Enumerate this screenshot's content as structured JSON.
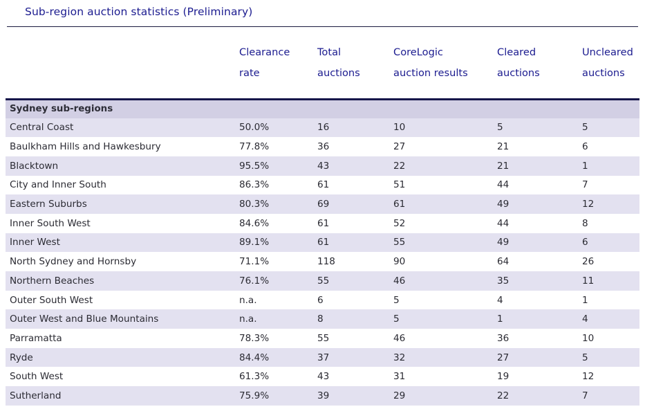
{
  "title": "Sub-region auction statistics (Preliminary)",
  "columns": [
    {
      "key": "region",
      "line1": "",
      "line2": ""
    },
    {
      "key": "rate",
      "line1": "Clearance",
      "line2": "rate"
    },
    {
      "key": "total",
      "line1": "Total",
      "line2": "auctions"
    },
    {
      "key": "core",
      "line1": "CoreLogic",
      "line2": "auction results"
    },
    {
      "key": "cleared",
      "line1": "Cleared",
      "line2": "auctions"
    },
    {
      "key": "uncleared",
      "line1": "Uncleared",
      "line2": "auctions"
    }
  ],
  "section_label": "Sydney sub-regions",
  "colors": {
    "title": "#1b1b8f",
    "header_text": "#1b1b8f",
    "section_bg": "#d2cfe4",
    "row_alt_bg": "#e3e1f0",
    "row_bg": "#ffffff",
    "rule_navy": "#15154a",
    "data_text": "#2b2b33"
  },
  "chart_data": {
    "type": "table",
    "title": "Sub-region auction statistics (Preliminary)",
    "group": "Sydney sub-regions",
    "columns": [
      "Sydney sub-regions",
      "Clearance rate",
      "Total auctions",
      "CoreLogic auction results",
      "Cleared auctions",
      "Uncleared auctions"
    ],
    "rows": [
      {
        "region": "Central Coast",
        "rate": "50.0%",
        "total": "16",
        "core": "10",
        "cleared": "5",
        "uncleared": "5"
      },
      {
        "region": "Baulkham Hills and Hawkesbury",
        "rate": "77.8%",
        "total": "36",
        "core": "27",
        "cleared": "21",
        "uncleared": "6"
      },
      {
        "region": "Blacktown",
        "rate": "95.5%",
        "total": "43",
        "core": "22",
        "cleared": "21",
        "uncleared": "1"
      },
      {
        "region": "City and Inner South",
        "rate": "86.3%",
        "total": "61",
        "core": "51",
        "cleared": "44",
        "uncleared": "7"
      },
      {
        "region": "Eastern Suburbs",
        "rate": "80.3%",
        "total": "69",
        "core": "61",
        "cleared": "49",
        "uncleared": "12"
      },
      {
        "region": "Inner South West",
        "rate": "84.6%",
        "total": "61",
        "core": "52",
        "cleared": "44",
        "uncleared": "8"
      },
      {
        "region": "Inner West",
        "rate": "89.1%",
        "total": "61",
        "core": "55",
        "cleared": "49",
        "uncleared": "6"
      },
      {
        "region": "North Sydney and Hornsby",
        "rate": "71.1%",
        "total": "118",
        "core": "90",
        "cleared": "64",
        "uncleared": "26"
      },
      {
        "region": "Northern Beaches",
        "rate": "76.1%",
        "total": "55",
        "core": "46",
        "cleared": "35",
        "uncleared": "11"
      },
      {
        "region": "Outer South West",
        "rate": "n.a.",
        "total": "6",
        "core": "5",
        "cleared": "4",
        "uncleared": "1"
      },
      {
        "region": "Outer West and Blue Mountains",
        "rate": "n.a.",
        "total": "8",
        "core": "5",
        "cleared": "1",
        "uncleared": "4"
      },
      {
        "region": "Parramatta",
        "rate": "78.3%",
        "total": "55",
        "core": "46",
        "cleared": "36",
        "uncleared": "10"
      },
      {
        "region": "Ryde",
        "rate": "84.4%",
        "total": "37",
        "core": "32",
        "cleared": "27",
        "uncleared": "5"
      },
      {
        "region": "South West",
        "rate": "61.3%",
        "total": "43",
        "core": "31",
        "cleared": "19",
        "uncleared": "12"
      },
      {
        "region": "Sutherland",
        "rate": "75.9%",
        "total": "39",
        "core": "29",
        "cleared": "22",
        "uncleared": "7"
      }
    ]
  }
}
